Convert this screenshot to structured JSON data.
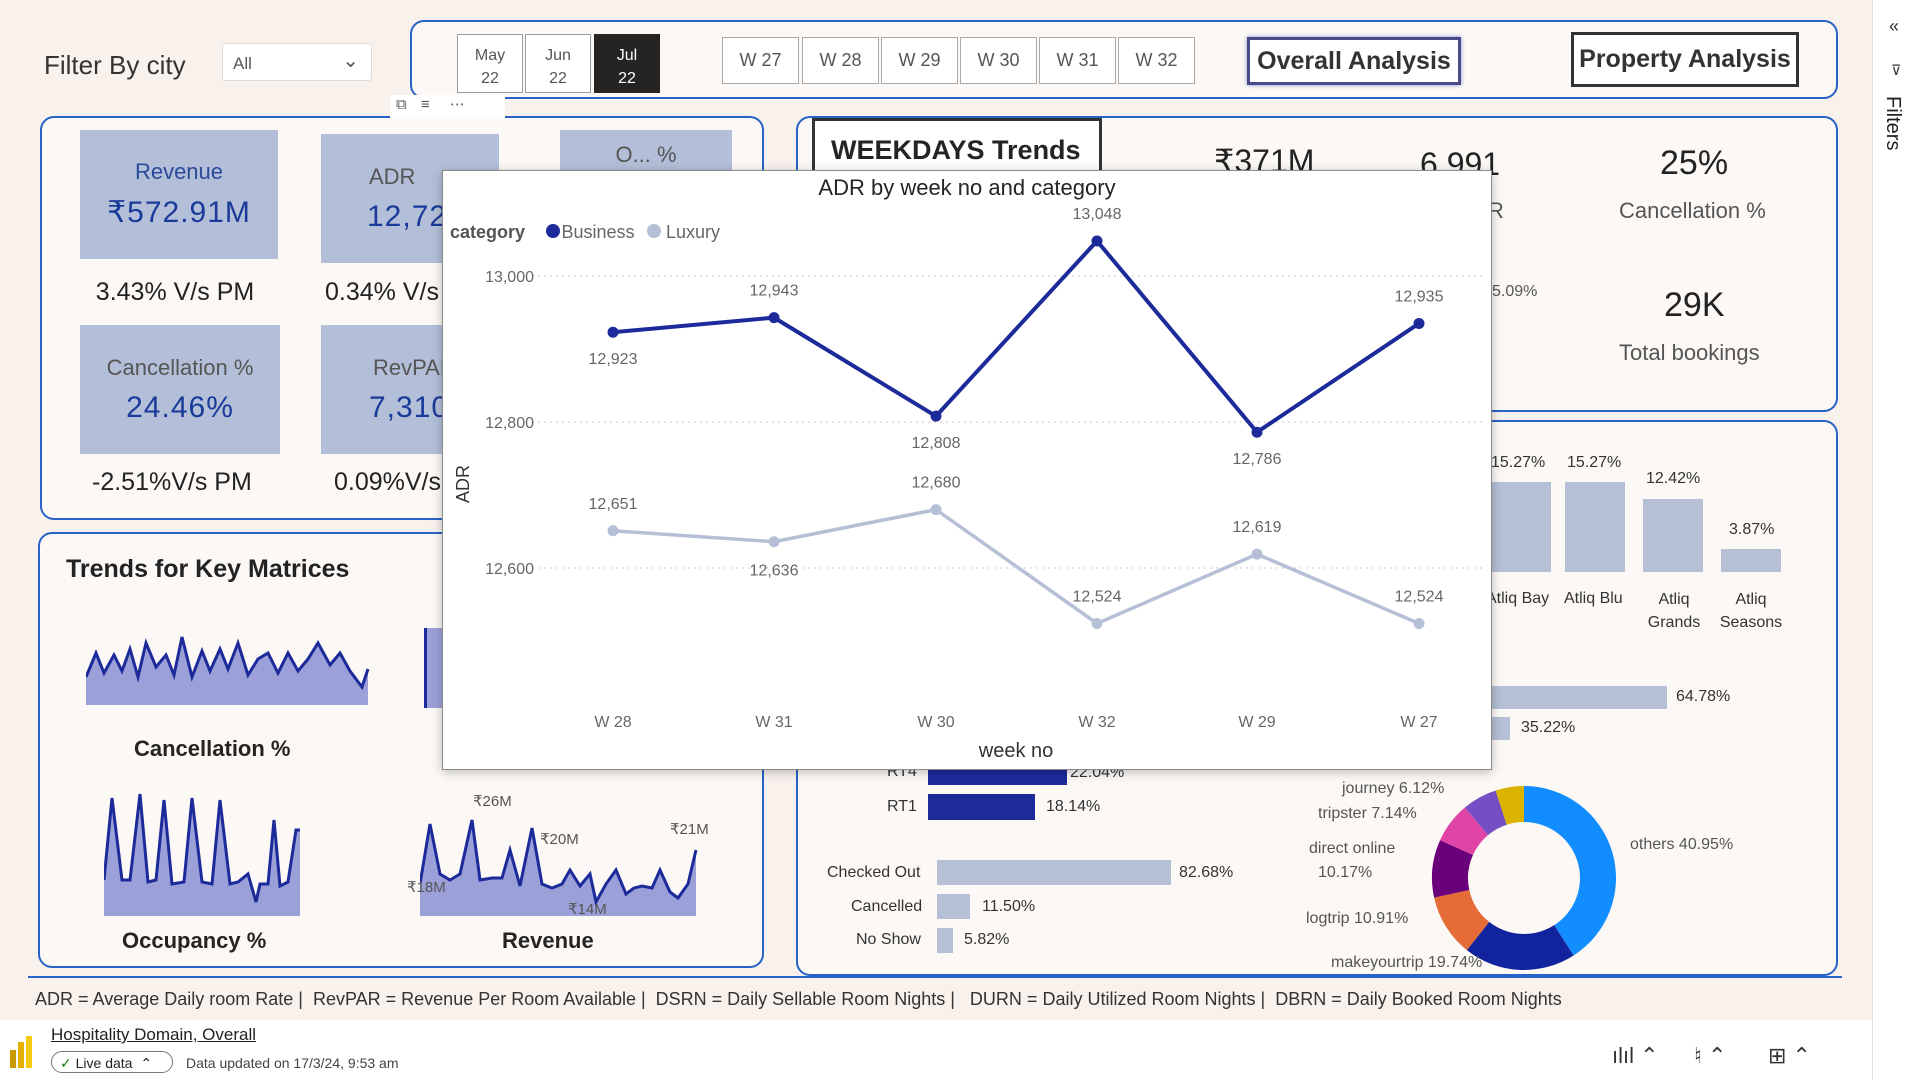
{
  "filter": {
    "label": "Filter By city",
    "selected": "All"
  },
  "months": [
    {
      "m": "May",
      "y": "22"
    },
    {
      "m": "Jun",
      "y": "22"
    },
    {
      "m": "Jul",
      "y": "22"
    }
  ],
  "weeks": [
    "W 27",
    "W 28",
    "W 29",
    "W 30",
    "W 31",
    "W 32"
  ],
  "nav": {
    "overall": "Overall Analysis",
    "property": "Property Analysis"
  },
  "kpis": {
    "revenue": {
      "label": "Revenue",
      "value": "₹572.91M",
      "change": "3.43% V/s PM"
    },
    "adr": {
      "label": "ADR",
      "value": "12,72",
      "change": "0.34% V/s"
    },
    "occupancy": {
      "label": "O... %"
    },
    "cancellation": {
      "label": "Cancellation %",
      "value": "24.46%",
      "change": "-2.51%V/s PM"
    },
    "revpar": {
      "label": "RevPAR",
      "value": "7,310",
      "change": "0.09%V/s"
    }
  },
  "trends": {
    "title": "Trends for Key Matrices",
    "cancellation_label": "Cancellation %",
    "occupancy_label": "Occupancy %",
    "revenue_label": "Revenue",
    "rev_annotations": [
      "₹26M",
      "₹20M",
      "₹21M",
      "₹18M",
      "₹14M"
    ]
  },
  "weekdays": {
    "title": "WEEKDAYS Trends",
    "value1": "₹371M",
    "value2": "6,991",
    "partial_r": "R",
    "pct_partial": "5.09%",
    "cancel_value": "25%",
    "cancel_label": "Cancellation %",
    "bookings_value": "29K",
    "bookings_label": "Total bookings"
  },
  "property_bars": [
    {
      "name": "Atliq Bay",
      "pct": "15.27%",
      "value": 15.27
    },
    {
      "name": "Atliq Blu",
      "pct": "15.27%",
      "value": 15.27
    },
    {
      "name": "Atliq Grands",
      "pct": "12.42%",
      "value": 12.42
    },
    {
      "name": "Atliq Seasons",
      "pct": "3.87%",
      "value": 3.87
    }
  ],
  "hbars_top": [
    {
      "pct": "64.78%",
      "value": 64.78
    },
    {
      "pct": "35.22%",
      "value": 35.22
    }
  ],
  "room_bars": [
    {
      "name": "RT4",
      "pct": "22.04%",
      "value": 22.04
    },
    {
      "name": "RT1",
      "pct": "18.14%",
      "value": 18.14
    }
  ],
  "status_bars": [
    {
      "name": "Checked Out",
      "pct": "82.68%",
      "value": 82.68
    },
    {
      "name": "Cancelled",
      "pct": "11.50%",
      "value": 11.5
    },
    {
      "name": "No Show",
      "pct": "5.82%",
      "value": 5.82
    }
  ],
  "donut": [
    {
      "label": "others 40.95%",
      "value": 40.95,
      "color": "#118dff"
    },
    {
      "label": "makeyourtrip 19.74%",
      "value": 19.74,
      "color": "#12239e"
    },
    {
      "label": "logtrip 10.91%",
      "value": 10.91,
      "color": "#e66c37"
    },
    {
      "label": "direct online 10.17%",
      "value": 10.17,
      "color": "#6b007b"
    },
    {
      "label": "tripster 7.14%",
      "value": 7.14,
      "color": "#e044a7"
    },
    {
      "label": "journey 6.12%",
      "value": 6.12,
      "color": "#744ec2"
    },
    {
      "label": "",
      "value": 5.0,
      "color": "#d9b300"
    }
  ],
  "donut_labels": {
    "journey": "journey 6.12%",
    "tripster": "tripster 7.14%",
    "direct1": "direct online",
    "direct2": "10.17%",
    "logtrip": "logtrip 10.91%",
    "makeyourtrip": "makeyourtrip 19.74%",
    "others": "others 40.95%"
  },
  "footer": {
    "definitions": "ADR = Average Daily room Rate |  RevPAR = Revenue Per Room Available |  DSRN = Daily Sellable Room Nights |   DURN = Daily Utilized Room Nights |  DBRN = Daily Booked Room Nights",
    "report_name": "Hospitality Domain, Overall",
    "live": "Live data",
    "updated": "Data updated on 17/3/24, 9:53 am"
  },
  "filters_pane": "Filters",
  "colors": {
    "business": "#1c2a9a",
    "luxury": "#b5bfd6",
    "accent": "#2a63c7"
  },
  "chart_data": {
    "type": "line",
    "title": "ADR by week no and category",
    "legend_title": "category",
    "xlabel": "week no",
    "ylabel": "ADR",
    "categories": [
      "W 28",
      "W 31",
      "W 30",
      "W 32",
      "W 29",
      "W 27"
    ],
    "yticks": [
      "13,000",
      "12,800",
      "12,600"
    ],
    "ylim": [
      12480,
      13120
    ],
    "series": [
      {
        "name": "Business",
        "values": [
          12923,
          12943,
          12808,
          13048,
          12786,
          12935
        ],
        "labels": [
          "12,923",
          "12,943",
          "12,808",
          "13,048",
          "12,786",
          "12,935"
        ]
      },
      {
        "name": "Luxury",
        "values": [
          12651,
          12636,
          12680,
          12524,
          12619,
          12524
        ],
        "labels": [
          "12,651",
          "12,636",
          "12,680",
          "12,524",
          "12,619",
          "12,524"
        ]
      }
    ],
    "grid": true,
    "legend_position": "top-left"
  }
}
